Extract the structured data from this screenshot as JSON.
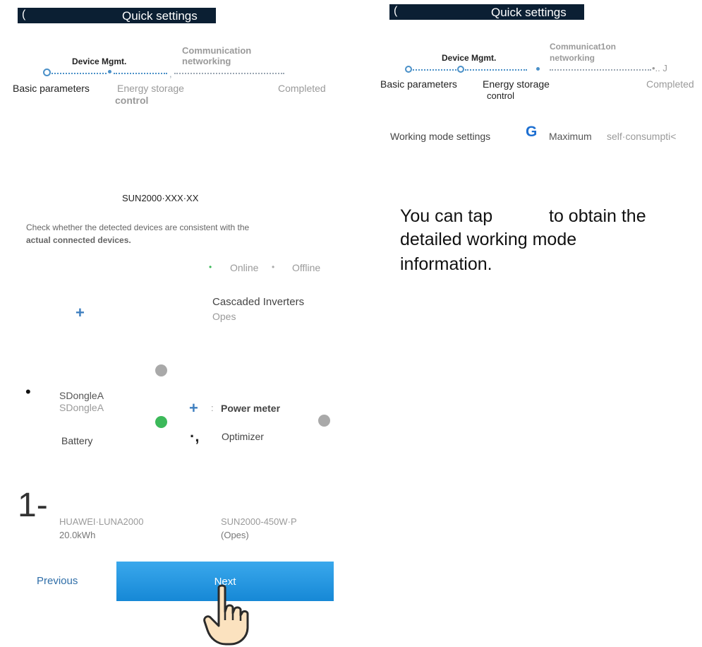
{
  "left_screen": {
    "back_glyph": "(",
    "title": "Quick settings",
    "stepper": {
      "step1_label": "Basic parameters",
      "step2_label_top": "Device Mgmt.",
      "step2_label_bottom_line1": "Energy storage",
      "step2_label_bottom_line2": "control",
      "step3_label_line1": "Communication",
      "step3_label_line2": "networking",
      "step4_label": "Completed",
      "marker_text": ","
    },
    "device_name": "SUN2000·XXX·XX",
    "instruction_line1": "Check whether the detected devices are consistent with the",
    "instruction_line2": "actual connected devices.",
    "legend": {
      "online_label": "Online",
      "offline_label": "Offline",
      "online_color": "#3cb95a",
      "offline_color": "#a9a9a9"
    },
    "cascaded_inverters": {
      "label": "Cascaded Inverters",
      "value": "Opes"
    },
    "sdongle": {
      "name": "SDongleA",
      "model": "SDongleA"
    },
    "battery_label": "Battery",
    "power_meter": {
      "separator": ":",
      "label": "Power meter"
    },
    "optimizer": {
      "glyph": "·,",
      "label": "Optimizer"
    },
    "battery_glyph": "1-",
    "battery_device": {
      "model": "HUAWEI·LUNA2000",
      "capacity": "20.0kWh"
    },
    "optimizer_device": {
      "model": "SUN2000-450W·P",
      "value": "(Opes)"
    },
    "buttons": {
      "previous": "Previous",
      "next": "Next"
    }
  },
  "right_screen": {
    "back_glyph": "(",
    "title": "Quick settings",
    "stepper": {
      "step1_label": "Basic parameters",
      "step2_label_top": "Device Mgmt.",
      "step2_label_bottom_line1": "Energy storage",
      "step2_label_bottom_line2": "control",
      "step3_label_line1": "Communicat1on",
      "step3_label_line2": "networking",
      "step4_label": "Completed",
      "end_text": "•.. J"
    },
    "working_mode": {
      "label": "Working mode settings",
      "icon_glyph": "G",
      "value_part1": "Maximum",
      "value_part2": "self·consumpti<"
    },
    "callout_line1_part1": "You can tap",
    "callout_line1_part2": "to obtain the",
    "callout_line2": "detailed working mode",
    "callout_line3": "information."
  },
  "colors": {
    "title_bar": "#0b1f33",
    "accent_blue": "#4a90c8",
    "button_blue": "#1a8ad8",
    "online_green": "#3cb95a",
    "offline_grey": "#a9a9a9"
  }
}
